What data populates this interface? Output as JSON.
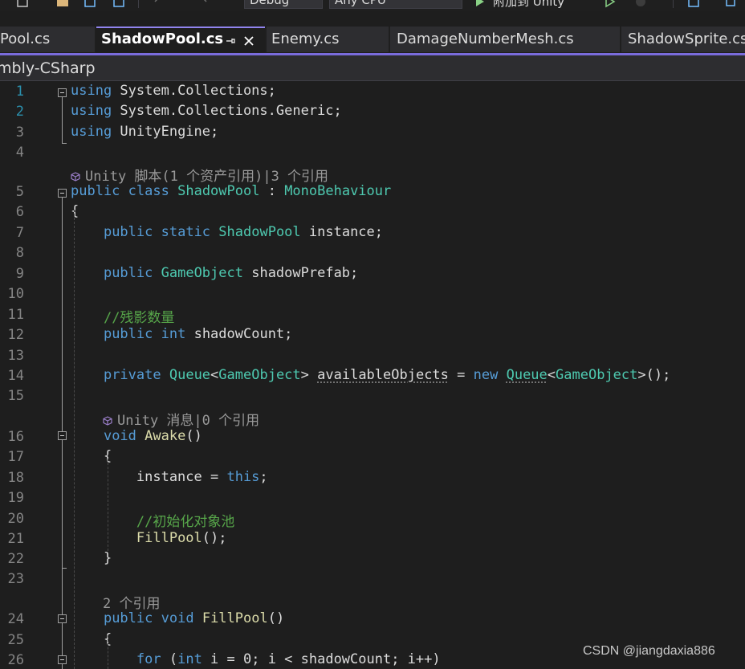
{
  "toolbar": {
    "config_value": "Debug",
    "platform_value": "Any CPU",
    "attach_label": "附加到 Unity"
  },
  "tabs": [
    {
      "label": "Pool.cs",
      "active": false
    },
    {
      "label": "ShadowPool.cs",
      "active": true
    },
    {
      "label": "Enemy.cs",
      "active": false
    },
    {
      "label": "DamageNumberMesh.cs",
      "active": false
    },
    {
      "label": "ShadowSprite.cs",
      "active": false
    }
  ],
  "navbar": {
    "project": "mbly-CSharp"
  },
  "colors": {
    "background": "#1e1e1e",
    "keyword": "#569cd6",
    "type": "#4ec9b0",
    "method": "#dcdcaa",
    "comment": "#57a64a",
    "line_number": "#2b91af",
    "accent": "#7a6cdc"
  },
  "editor": {
    "lines": [
      {
        "n": "1",
        "tokens": [
          [
            "kw",
            "using"
          ],
          [
            "vr",
            " System.Collections;"
          ]
        ]
      },
      {
        "n": "2",
        "tokens": [
          [
            "kw",
            "using"
          ],
          [
            "vr",
            " System.Collections.Generic;"
          ]
        ]
      },
      {
        "n": "3",
        "tokens": [
          [
            "kw",
            "using"
          ],
          [
            "vr",
            " UnityEngine;"
          ]
        ]
      },
      {
        "n": "4",
        "tokens": []
      },
      {
        "lens": "Unity 脚本(1 个资产引用)|3 个引用",
        "icon": true
      },
      {
        "n": "5",
        "tokens": [
          [
            "kw",
            "public"
          ],
          [
            "vr",
            " "
          ],
          [
            "kw",
            "class"
          ],
          [
            "vr",
            " "
          ],
          [
            "ty",
            "ShadowPool"
          ],
          [
            "vr",
            " : "
          ],
          [
            "ty",
            "MonoBehaviour"
          ]
        ]
      },
      {
        "n": "6",
        "tokens": [
          [
            "vr",
            "{"
          ]
        ]
      },
      {
        "n": "7",
        "tokens": [
          [
            "vr",
            "    "
          ],
          [
            "kw",
            "public"
          ],
          [
            "vr",
            " "
          ],
          [
            "kw",
            "static"
          ],
          [
            "vr",
            " "
          ],
          [
            "ty",
            "ShadowPool"
          ],
          [
            "vr",
            " instance;"
          ]
        ]
      },
      {
        "n": "8",
        "tokens": []
      },
      {
        "n": "9",
        "tokens": [
          [
            "vr",
            "    "
          ],
          [
            "kw",
            "public"
          ],
          [
            "vr",
            " "
          ],
          [
            "ty",
            "GameObject"
          ],
          [
            "vr",
            " shadowPrefab;"
          ]
        ]
      },
      {
        "n": "10",
        "tokens": []
      },
      {
        "n": "11",
        "tokens": [
          [
            "vr",
            "    "
          ],
          [
            "cm",
            "//残影数量"
          ]
        ]
      },
      {
        "n": "12",
        "tokens": [
          [
            "vr",
            "    "
          ],
          [
            "kw",
            "public"
          ],
          [
            "vr",
            " "
          ],
          [
            "kw",
            "int"
          ],
          [
            "vr",
            " shadowCount;"
          ]
        ]
      },
      {
        "n": "13",
        "tokens": []
      },
      {
        "n": "14",
        "tokens": [
          [
            "vr",
            "    "
          ],
          [
            "kw",
            "private"
          ],
          [
            "vr",
            " "
          ],
          [
            "ty",
            "Queue"
          ],
          [
            "vr",
            "<"
          ],
          [
            "ty",
            "GameObject"
          ],
          [
            "vr",
            "> "
          ],
          [
            "sq",
            "availableObjects"
          ],
          [
            "vr",
            " = "
          ],
          [
            "kw",
            "new"
          ],
          [
            "vr",
            " "
          ],
          [
            "tysq",
            "Queue"
          ],
          [
            "vr",
            "<"
          ],
          [
            "ty",
            "GameObject"
          ],
          [
            "vr",
            ">();"
          ]
        ]
      },
      {
        "n": "15",
        "tokens": []
      },
      {
        "lens": "Unity 消息|0 个引用",
        "icon": true
      },
      {
        "n": "16",
        "tokens": [
          [
            "vr",
            "    "
          ],
          [
            "kw",
            "void"
          ],
          [
            "vr",
            " "
          ],
          [
            "fn",
            "Awake"
          ],
          [
            "vr",
            "()"
          ]
        ]
      },
      {
        "n": "17",
        "tokens": [
          [
            "vr",
            "    {"
          ]
        ]
      },
      {
        "n": "18",
        "tokens": [
          [
            "vr",
            "        instance = "
          ],
          [
            "kw",
            "this"
          ],
          [
            "vr",
            ";"
          ]
        ]
      },
      {
        "n": "19",
        "tokens": []
      },
      {
        "n": "20",
        "tokens": [
          [
            "vr",
            "        "
          ],
          [
            "cm",
            "//初始化对象池"
          ]
        ]
      },
      {
        "n": "21",
        "tokens": [
          [
            "vr",
            "        "
          ],
          [
            "fn",
            "FillPool"
          ],
          [
            "vr",
            "();"
          ]
        ]
      },
      {
        "n": "22",
        "tokens": [
          [
            "vr",
            "    }"
          ]
        ]
      },
      {
        "n": "23",
        "tokens": []
      },
      {
        "lens": "2 个引用",
        "icon": false
      },
      {
        "n": "24",
        "tokens": [
          [
            "vr",
            "    "
          ],
          [
            "kw",
            "public"
          ],
          [
            "vr",
            " "
          ],
          [
            "kw",
            "void"
          ],
          [
            "vr",
            " "
          ],
          [
            "fn",
            "FillPool"
          ],
          [
            "vr",
            "()"
          ]
        ]
      },
      {
        "n": "25",
        "tokens": [
          [
            "vr",
            "    {"
          ]
        ]
      },
      {
        "n": "26",
        "tokens": [
          [
            "vr",
            "        "
          ],
          [
            "kw",
            "for"
          ],
          [
            "vr",
            " ("
          ],
          [
            "kw",
            "int"
          ],
          [
            "vr",
            " i = 0; i < shadowCount; i++)"
          ]
        ]
      }
    ]
  },
  "watermark": "CSDN @jiangdaxia886"
}
